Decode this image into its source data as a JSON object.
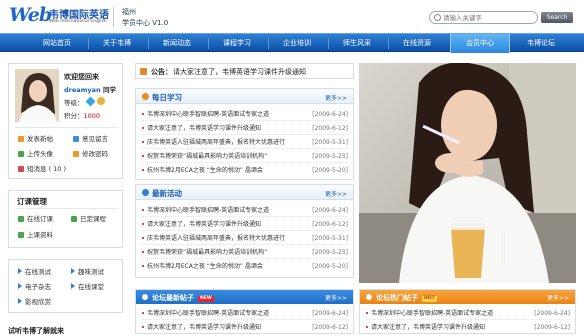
{
  "header": {
    "logo_mark": "Web",
    "logo_cn": "韦博国际英语",
    "logo_en": "Web International English",
    "location": "福州",
    "center": "学员中心 V1.0",
    "search_placeholder": "请输入关键字",
    "search_button": "Search"
  },
  "nav": [
    "网站首页",
    "关于韦博",
    "新闻动态",
    "课程学习",
    "企业培训",
    "师生风采",
    "在线资源",
    "会员中心",
    "韦博论坛"
  ],
  "nav_active": 7,
  "user": {
    "welcome": "欢迎您回来",
    "username": "dreamyan",
    "role": "同学",
    "level_label": "等级：",
    "points_label": "积分：",
    "points": "1000",
    "links": [
      "发表新帖",
      "意见留言",
      "上传头像",
      "修改密码",
      "短消息 ( 10 )"
    ]
  },
  "subscriptions": {
    "title": "订课管理",
    "links": [
      "在线订课",
      "已定课程",
      "上课资料"
    ]
  },
  "tests": {
    "links": [
      "在线测试",
      "趣味测试",
      "电子杂志",
      "在线课堂",
      "影视欣赏"
    ]
  },
  "bottom_left": "试听韦博了解就来",
  "notice": {
    "label": "公告：",
    "text": "请大家注意了，韦博英语学习课件升级通知"
  },
  "daily": {
    "title": "每日学习",
    "more": "更多>>",
    "rows": [
      {
        "text": "韦博深圳中心联手智联招聘-英语面试专家之道",
        "date": "[2009-6-24]"
      },
      {
        "text": "请大家注意了，韦博英语学习课件升级通知",
        "date": "[2009-6-12]"
      },
      {
        "text": "庆韦博英语入驻福城两周年盛典，报名特大优惠进行",
        "date": "[2009-5-31]"
      },
      {
        "text": "祝贺韦博荣获“福城最具影响力英语培训机构”",
        "date": "[2009-5-25]"
      },
      {
        "text": "杭州韦博2月ECA之夜 “生命的悦动” 晶酒会",
        "date": "[2009-5-20]"
      }
    ]
  },
  "activities": {
    "title": "最新活动",
    "more": "更多>>",
    "rows": [
      {
        "text": "韦博深圳中心联手智联招聘-英语面试专家之道",
        "date": "[2009-6-24]"
      },
      {
        "text": "请大家注意了，韦博英语学习课件升级通知",
        "date": "[2009-6-12]"
      },
      {
        "text": "庆韦博英语入驻福城两周年盛典，报名特大优惠进行",
        "date": "[2009-5-31]"
      },
      {
        "text": "祝贺韦博荣获“福城最具影响力英语培训机构”",
        "date": "[2009-5-25]"
      },
      {
        "text": "杭州韦博2月ECA之夜 “生命的悦动” 晶酒会",
        "date": "[2009-5-20]"
      }
    ]
  },
  "forum_new": {
    "title": "论坛最新帖子",
    "tag": "NEW",
    "more": "更多>>",
    "rows": [
      {
        "text": "韦博深圳中心联手智联招聘-英语面试专家之道",
        "date": "[2009-6-24]"
      },
      {
        "text": "请大家注意了，韦博英语学习课件升级通知",
        "date": "[2009-6-12]"
      }
    ]
  },
  "forum_hot": {
    "title": "论坛热门帖子",
    "tag": "HOT",
    "more": "更多>>",
    "rows": [
      {
        "text": "韦博深圳中心联手智联招聘-英语面试专家之道",
        "date": "[2009-6-24]"
      },
      {
        "text": "请大家注意了，韦博英语学习课件升级通知",
        "date": "[2009-6-12]"
      }
    ]
  },
  "colors": {
    "nav": "#0b4fa6",
    "accent": "#1b5fb4",
    "forum_new_bar": "#1f6fc8",
    "forum_hot_bar": "#f08a1c"
  }
}
